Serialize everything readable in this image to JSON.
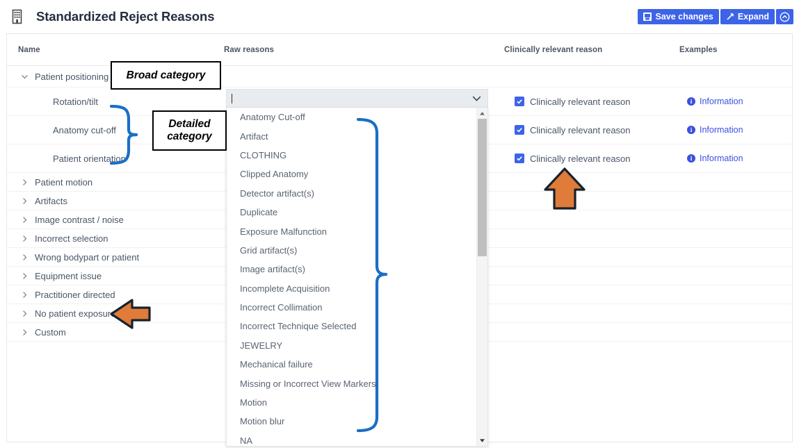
{
  "header": {
    "icon": "building-icon",
    "title": "Standardized Reject Reasons",
    "buttons": {
      "save": "Save changes",
      "save_icon": "save-disk-icon",
      "expand": "Expand",
      "expand_icon": "diagonal-arrow-icon",
      "collapse_icon": "circle-chevron-up-icon"
    },
    "accent_color": "#3c63e8"
  },
  "table": {
    "columns": [
      "Name",
      "Raw reasons",
      "Clinically relevant reason",
      "Examples"
    ],
    "rows": [
      {
        "name": "Patient positioning",
        "level": 0,
        "expanded": true,
        "icon": "chevron-down-icon",
        "has_controls": false
      },
      {
        "name": "Rotation/tilt",
        "level": 1,
        "expanded": false,
        "icon": "",
        "has_controls": true
      },
      {
        "name": "Anatomy cut-off",
        "level": 1,
        "expanded": false,
        "icon": "",
        "has_controls": true
      },
      {
        "name": "Patient orientation",
        "level": 1,
        "expanded": false,
        "icon": "",
        "has_controls": true
      },
      {
        "name": "Patient motion",
        "level": 0,
        "expanded": false,
        "icon": "chevron-right-icon",
        "has_controls": false
      },
      {
        "name": "Artifacts",
        "level": 0,
        "expanded": false,
        "icon": "chevron-right-icon",
        "has_controls": false
      },
      {
        "name": "Image contrast / noise",
        "level": 0,
        "expanded": false,
        "icon": "chevron-right-icon",
        "has_controls": false
      },
      {
        "name": "Incorrect selection",
        "level": 0,
        "expanded": false,
        "icon": "chevron-right-icon",
        "has_controls": false
      },
      {
        "name": "Wrong bodypart or patient",
        "level": 0,
        "expanded": false,
        "icon": "chevron-right-icon",
        "has_controls": false
      },
      {
        "name": "Equipment issue",
        "level": 0,
        "expanded": false,
        "icon": "chevron-right-icon",
        "has_controls": false
      },
      {
        "name": "Practitioner directed",
        "level": 0,
        "expanded": false,
        "icon": "chevron-right-icon",
        "has_controls": false
      },
      {
        "name": "No patient exposure",
        "level": 0,
        "expanded": false,
        "icon": "chevron-right-icon",
        "has_controls": false
      },
      {
        "name": "Custom",
        "level": 0,
        "expanded": false,
        "icon": "chevron-right-icon",
        "has_controls": false
      }
    ],
    "clinically_relevant_label": "Clinically relevant reason",
    "clinically_relevant_checked": true,
    "examples_label": "Information",
    "checkbox_color": "#3c63e8",
    "link_color": "#3c50e0"
  },
  "combobox": {
    "value": "",
    "placeholder": "",
    "open": true,
    "arrow_icon": "chevron-down-icon",
    "options": [
      "Anatomy Cut-off",
      "Artifact",
      "CLOTHING",
      "Clipped Anatomy",
      "Detector artifact(s)",
      "Duplicate",
      "Exposure Malfunction",
      "Grid artifact(s)",
      "Image artifact(s)",
      "Incomplete Acquisition",
      "Incorrect Collimation",
      "Incorrect Technique Selected",
      "JEWELRY",
      "Mechanical failure",
      "Missing or Incorrect View Markers",
      "Motion",
      "Motion blur",
      "NA"
    ],
    "scrollbar": {
      "up_icon": "triangle-up-icon",
      "down_icon": "triangle-down-icon"
    }
  },
  "annotations": {
    "broad_category": "Broad category",
    "detailed_category": "Detailed category",
    "bracket_color": "#1a6fc4",
    "arrow_fill": "#e07b39",
    "arrow_stroke": "#15232e",
    "arrow_left_target": "No patient exposure",
    "arrow_up_target": "Clinically relevant reason"
  }
}
